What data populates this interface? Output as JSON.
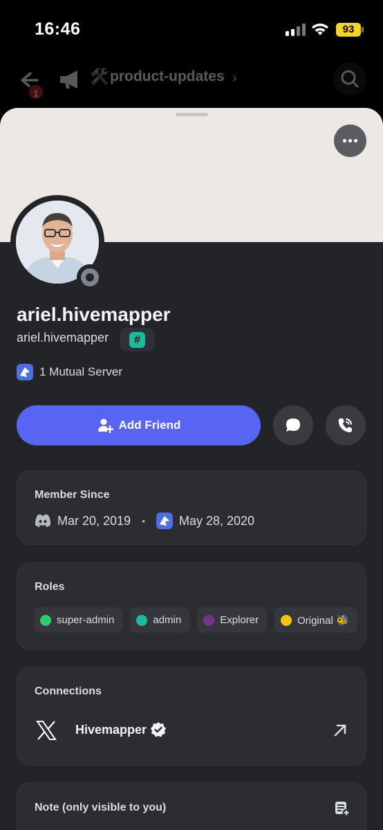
{
  "status_bar": {
    "time": "16:46",
    "battery": "93"
  },
  "channel_header": {
    "unread_count": "1",
    "channel_name": "product-updates",
    "emoji": "🛠️"
  },
  "profile": {
    "display_name": "ariel.hivemapper",
    "username": "ariel.hivemapper",
    "tag_badge": "#",
    "mutual_servers": "1 Mutual Server",
    "status": "offline"
  },
  "actions": {
    "add_friend_label": "Add Friend"
  },
  "member_since": {
    "title": "Member Since",
    "discord_date": "Mar 20, 2019",
    "separator": "•",
    "server_date": "May 28, 2020"
  },
  "roles": {
    "title": "Roles",
    "items": [
      {
        "label": "super-admin",
        "color": "#2ecc71"
      },
      {
        "label": "admin",
        "color": "#1abc9c"
      },
      {
        "label": "Explorer",
        "color": "#71368a"
      },
      {
        "label": "Original 🐝",
        "color": "#f1c40f"
      }
    ]
  },
  "connections": {
    "title": "Connections",
    "items": [
      {
        "name": "Hivemapper",
        "service_icon": "x-logo-icon",
        "verified": true
      }
    ]
  },
  "note": {
    "title": "Note (only visible to you)"
  },
  "colors": {
    "accent": "#5865f2",
    "background": "#232428",
    "card": "#2b2d31",
    "banner": "#ece8e4"
  }
}
